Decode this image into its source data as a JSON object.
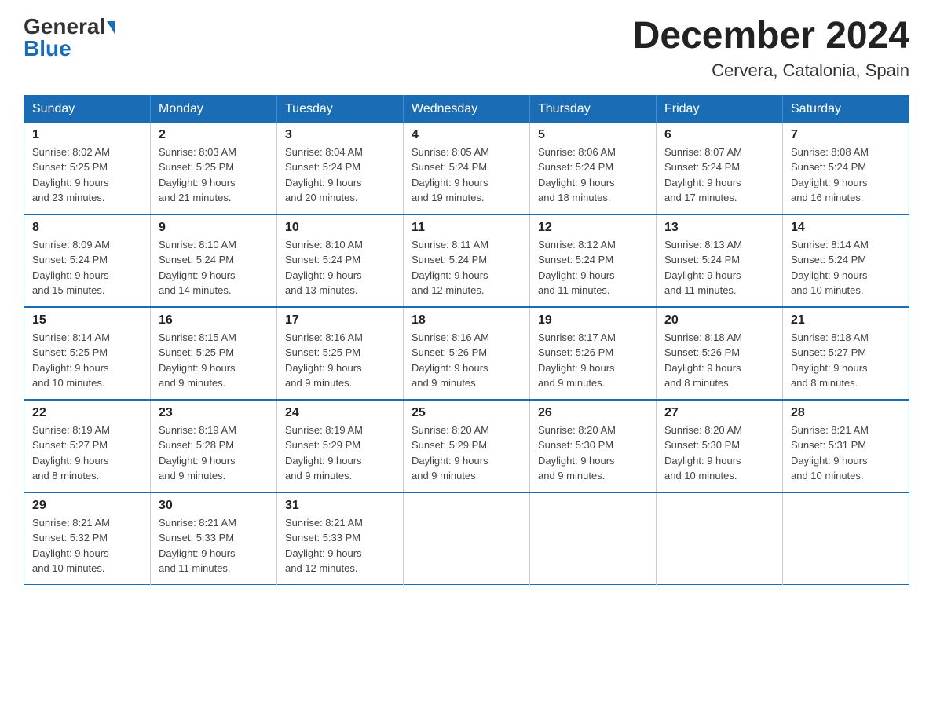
{
  "header": {
    "logo_general": "General",
    "logo_blue": "Blue",
    "title": "December 2024",
    "subtitle": "Cervera, Catalonia, Spain"
  },
  "days_of_week": [
    "Sunday",
    "Monday",
    "Tuesday",
    "Wednesday",
    "Thursday",
    "Friday",
    "Saturday"
  ],
  "weeks": [
    [
      {
        "day": "1",
        "sunrise": "8:02 AM",
        "sunset": "5:25 PM",
        "daylight": "9 hours and 23 minutes."
      },
      {
        "day": "2",
        "sunrise": "8:03 AM",
        "sunset": "5:25 PM",
        "daylight": "9 hours and 21 minutes."
      },
      {
        "day": "3",
        "sunrise": "8:04 AM",
        "sunset": "5:24 PM",
        "daylight": "9 hours and 20 minutes."
      },
      {
        "day": "4",
        "sunrise": "8:05 AM",
        "sunset": "5:24 PM",
        "daylight": "9 hours and 19 minutes."
      },
      {
        "day": "5",
        "sunrise": "8:06 AM",
        "sunset": "5:24 PM",
        "daylight": "9 hours and 18 minutes."
      },
      {
        "day": "6",
        "sunrise": "8:07 AM",
        "sunset": "5:24 PM",
        "daylight": "9 hours and 17 minutes."
      },
      {
        "day": "7",
        "sunrise": "8:08 AM",
        "sunset": "5:24 PM",
        "daylight": "9 hours and 16 minutes."
      }
    ],
    [
      {
        "day": "8",
        "sunrise": "8:09 AM",
        "sunset": "5:24 PM",
        "daylight": "9 hours and 15 minutes."
      },
      {
        "day": "9",
        "sunrise": "8:10 AM",
        "sunset": "5:24 PM",
        "daylight": "9 hours and 14 minutes."
      },
      {
        "day": "10",
        "sunrise": "8:10 AM",
        "sunset": "5:24 PM",
        "daylight": "9 hours and 13 minutes."
      },
      {
        "day": "11",
        "sunrise": "8:11 AM",
        "sunset": "5:24 PM",
        "daylight": "9 hours and 12 minutes."
      },
      {
        "day": "12",
        "sunrise": "8:12 AM",
        "sunset": "5:24 PM",
        "daylight": "9 hours and 11 minutes."
      },
      {
        "day": "13",
        "sunrise": "8:13 AM",
        "sunset": "5:24 PM",
        "daylight": "9 hours and 11 minutes."
      },
      {
        "day": "14",
        "sunrise": "8:14 AM",
        "sunset": "5:24 PM",
        "daylight": "9 hours and 10 minutes."
      }
    ],
    [
      {
        "day": "15",
        "sunrise": "8:14 AM",
        "sunset": "5:25 PM",
        "daylight": "9 hours and 10 minutes."
      },
      {
        "day": "16",
        "sunrise": "8:15 AM",
        "sunset": "5:25 PM",
        "daylight": "9 hours and 9 minutes."
      },
      {
        "day": "17",
        "sunrise": "8:16 AM",
        "sunset": "5:25 PM",
        "daylight": "9 hours and 9 minutes."
      },
      {
        "day": "18",
        "sunrise": "8:16 AM",
        "sunset": "5:26 PM",
        "daylight": "9 hours and 9 minutes."
      },
      {
        "day": "19",
        "sunrise": "8:17 AM",
        "sunset": "5:26 PM",
        "daylight": "9 hours and 9 minutes."
      },
      {
        "day": "20",
        "sunrise": "8:18 AM",
        "sunset": "5:26 PM",
        "daylight": "9 hours and 8 minutes."
      },
      {
        "day": "21",
        "sunrise": "8:18 AM",
        "sunset": "5:27 PM",
        "daylight": "9 hours and 8 minutes."
      }
    ],
    [
      {
        "day": "22",
        "sunrise": "8:19 AM",
        "sunset": "5:27 PM",
        "daylight": "9 hours and 8 minutes."
      },
      {
        "day": "23",
        "sunrise": "8:19 AM",
        "sunset": "5:28 PM",
        "daylight": "9 hours and 9 minutes."
      },
      {
        "day": "24",
        "sunrise": "8:19 AM",
        "sunset": "5:29 PM",
        "daylight": "9 hours and 9 minutes."
      },
      {
        "day": "25",
        "sunrise": "8:20 AM",
        "sunset": "5:29 PM",
        "daylight": "9 hours and 9 minutes."
      },
      {
        "day": "26",
        "sunrise": "8:20 AM",
        "sunset": "5:30 PM",
        "daylight": "9 hours and 9 minutes."
      },
      {
        "day": "27",
        "sunrise": "8:20 AM",
        "sunset": "5:30 PM",
        "daylight": "9 hours and 10 minutes."
      },
      {
        "day": "28",
        "sunrise": "8:21 AM",
        "sunset": "5:31 PM",
        "daylight": "9 hours and 10 minutes."
      }
    ],
    [
      {
        "day": "29",
        "sunrise": "8:21 AM",
        "sunset": "5:32 PM",
        "daylight": "9 hours and 10 minutes."
      },
      {
        "day": "30",
        "sunrise": "8:21 AM",
        "sunset": "5:33 PM",
        "daylight": "9 hours and 11 minutes."
      },
      {
        "day": "31",
        "sunrise": "8:21 AM",
        "sunset": "5:33 PM",
        "daylight": "9 hours and 12 minutes."
      },
      null,
      null,
      null,
      null
    ]
  ],
  "labels": {
    "sunrise": "Sunrise:",
    "sunset": "Sunset:",
    "daylight": "Daylight:"
  }
}
